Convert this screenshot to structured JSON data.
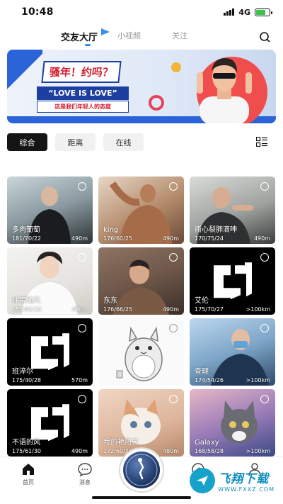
{
  "status_bar": {
    "time": "10:48",
    "network": "4G",
    "battery_level": 0.7
  },
  "top_tabs": [
    {
      "label": "交友大厅",
      "active": true
    },
    {
      "label": "小视频",
      "active": false
    },
    {
      "label": "关注",
      "active": false
    }
  ],
  "banner": {
    "title": "骚年！约吗？",
    "slogan": "“LOVE IS LOVE”",
    "subtitle": "这是我们年轻人的态度"
  },
  "filters": [
    {
      "label": "综合",
      "active": true
    },
    {
      "label": "距离",
      "active": false
    },
    {
      "label": "在线",
      "active": false
    }
  ],
  "users": [
    {
      "name": "多肉葡萄",
      "info": "181/70/22",
      "distance": "490m",
      "photo": "photo"
    },
    {
      "name": "king",
      "info": "176/60/25",
      "distance": "490m",
      "photo": "photo"
    },
    {
      "name": "撕心裂肺滴呻",
      "info": "170/75/24",
      "distance": "490m",
      "photo": "photo"
    },
    {
      "name": "往事随风",
      "info": "155/40/18",
      "distance": "490m",
      "photo": "photo"
    },
    {
      "name": "东东",
      "info": "176/66/25",
      "distance": "490m",
      "photo": "photo"
    },
    {
      "name": "艾伦",
      "info": "175/70/27",
      "distance": ">100km",
      "photo": "logo"
    },
    {
      "name": "班淬尔",
      "info": "175/40/28",
      "distance": "570m",
      "photo": "logo"
    },
    {
      "name": "",
      "info": "",
      "distance": "",
      "photo": "totoro"
    },
    {
      "name": "查理",
      "info": "174/54/26",
      "distance": ">100km",
      "photo": "photo"
    },
    {
      "name": "不语的风",
      "info": "175/61/30",
      "distance": "490m",
      "photo": "logo"
    },
    {
      "name": "我的艳阳天",
      "info": "172/60/28",
      "distance": "480m",
      "photo": "cat"
    },
    {
      "name": "Galaxy",
      "info": "168/58/28",
      "distance": ">100km",
      "photo": "cat"
    }
  ],
  "bottom_nav": [
    {
      "label": "首页",
      "icon": "home-icon"
    },
    {
      "label": "消息",
      "icon": "message-icon"
    }
  ],
  "watermark": {
    "title": "飞翔下载",
    "url": "WWW.FXXZ.COM"
  },
  "colors": {
    "accent": "#3b8df0",
    "dark": "#151515",
    "banner_blue": "#1d3fa0",
    "banner_red": "#d21f2e"
  }
}
